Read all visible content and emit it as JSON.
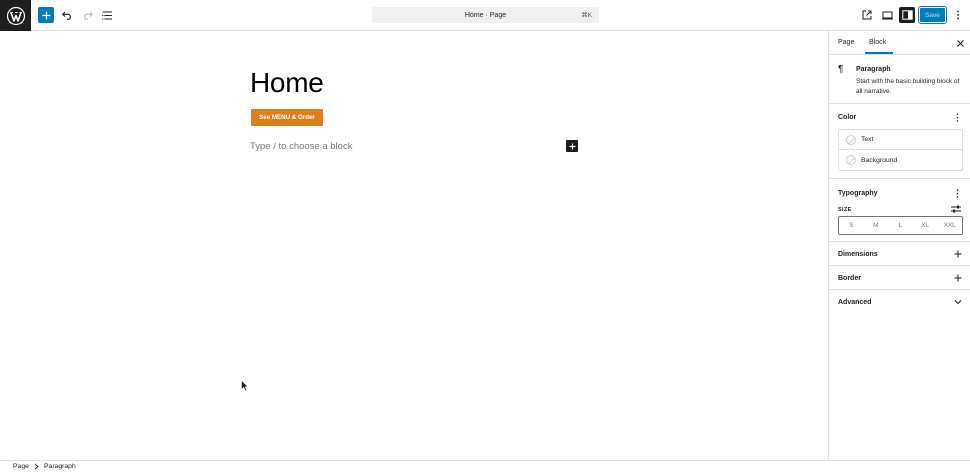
{
  "topbar": {
    "command_title": "Home · Page",
    "command_shortcut": "⌘K",
    "save_label": "Save"
  },
  "canvas": {
    "heading": "Home",
    "button_label": "See MENU & Order",
    "placeholder": "Type / to choose a block",
    "button_color": "#e27d1c"
  },
  "sidebar": {
    "tabs": [
      {
        "label": "Page",
        "active": false
      },
      {
        "label": "Block",
        "active": true
      }
    ],
    "block": {
      "icon": "paragraph-icon",
      "name": "Paragraph",
      "description": "Start with the basic building block of all narrative."
    },
    "color": {
      "title": "Color",
      "items": [
        "Text",
        "Background"
      ]
    },
    "typography": {
      "title": "Typography",
      "size_label": "SIZE",
      "sizes": [
        "S",
        "M",
        "L",
        "XL",
        "XXL"
      ]
    },
    "dimensions_title": "Dimensions",
    "border_title": "Border",
    "advanced_title": "Advanced"
  },
  "breadcrumb": [
    "Page",
    "Paragraph"
  ],
  "colors": {
    "accent": "#007cba",
    "dark": "#1e1e1e"
  }
}
